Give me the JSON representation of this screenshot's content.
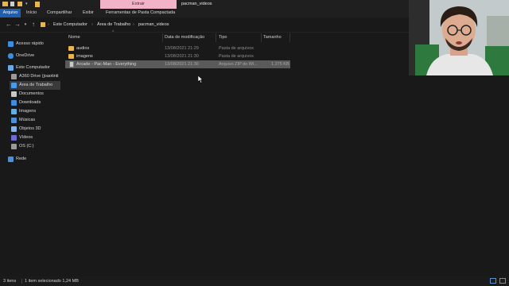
{
  "window": {
    "title": "pacman_videos",
    "context_tab": "Extrair",
    "context_tab_color": "#f2b2c8"
  },
  "ribbon": {
    "tabs": [
      "Arquivo",
      "Início",
      "Compartilhar",
      "Exibir",
      "Ferramentas de Pasta Compactada"
    ]
  },
  "address": {
    "breadcrumb": [
      "Este Computador",
      "Área de Trabalho",
      "pacman_videos"
    ]
  },
  "sidebar": {
    "items": [
      {
        "label": "Acesso rápido",
        "icon": "star-icon"
      },
      {
        "label": "OneDrive",
        "icon": "cloud-icon"
      },
      {
        "label": "Este Computador",
        "icon": "computer-icon"
      },
      {
        "label": "A360 Drive (joaotinti",
        "icon": "drive-icon"
      },
      {
        "label": "Área de Trabalho",
        "icon": "desktop-icon"
      },
      {
        "label": "Documentos",
        "icon": "document-icon"
      },
      {
        "label": "Downloads",
        "icon": "download-icon"
      },
      {
        "label": "Imagens",
        "icon": "image-icon"
      },
      {
        "label": "Músicas",
        "icon": "music-icon"
      },
      {
        "label": "Objetos 3D",
        "icon": "cube-icon"
      },
      {
        "label": "Vídeos",
        "icon": "video-icon"
      },
      {
        "label": "OS (C:)",
        "icon": "disk-icon"
      },
      {
        "label": "Rede",
        "icon": "network-icon"
      }
    ]
  },
  "columns": {
    "name": "Nome",
    "date": "Data de modificação",
    "type": "Tipo",
    "size": "Tamanho"
  },
  "files": [
    {
      "name": "audios",
      "date": "13/08/2021 21:29",
      "type": "Pasta de arquivos",
      "size": "",
      "icon": "folder-icon"
    },
    {
      "name": "imagens",
      "date": "13/08/2021 21:30",
      "type": "Pasta de arquivos",
      "size": "",
      "icon": "folder-icon"
    },
    {
      "name": "Arcade - Pac-Man - Everything",
      "date": "13/08/2021 21:30",
      "type": "Arquivo ZIP do Wi...",
      "size": "1.275 KB",
      "icon": "zip-icon",
      "selected": true
    }
  ],
  "status": {
    "item_count": "3 itens",
    "selection": "1 item selecionado  1,24 MB"
  },
  "colors": {
    "background": "#191919",
    "selection": "#5a5a5a",
    "accent": "#1f5fb0",
    "folder": "#e8b64a"
  }
}
